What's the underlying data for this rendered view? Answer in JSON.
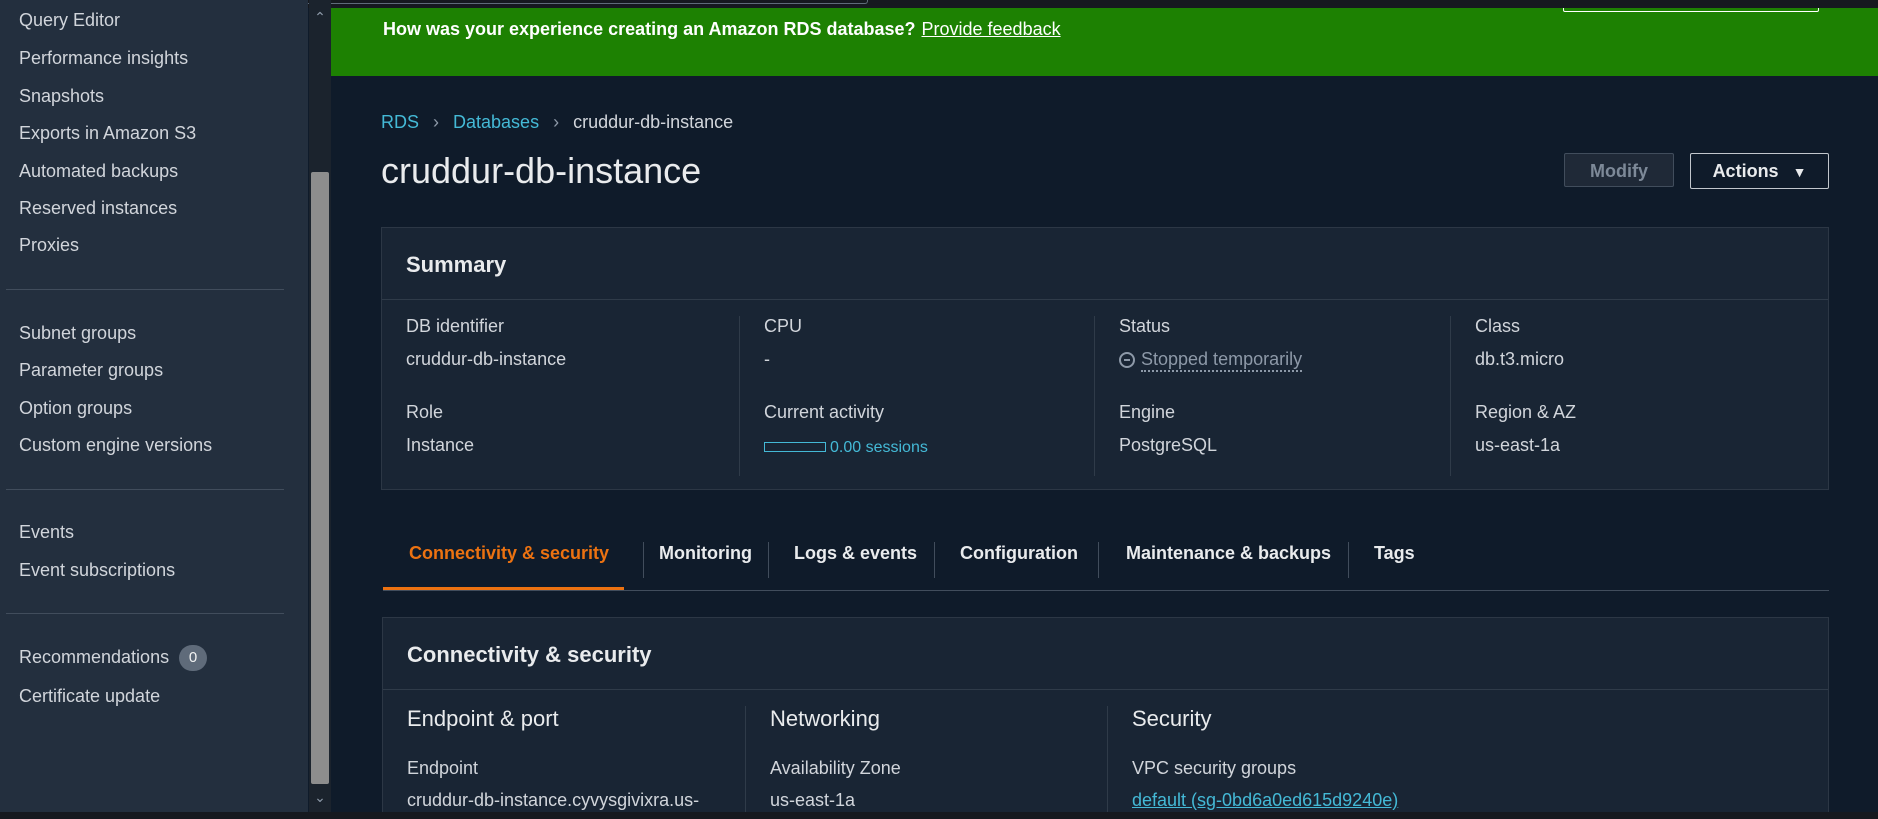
{
  "sidebar": {
    "items": [
      {
        "label": "Query Editor"
      },
      {
        "label": "Performance insights"
      },
      {
        "label": "Snapshots"
      },
      {
        "label": "Exports in Amazon S3"
      },
      {
        "label": "Automated backups"
      },
      {
        "label": "Reserved instances"
      },
      {
        "label": "Proxies"
      },
      {
        "label": "Subnet groups"
      },
      {
        "label": "Parameter groups"
      },
      {
        "label": "Option groups"
      },
      {
        "label": "Custom engine versions"
      },
      {
        "label": "Events"
      },
      {
        "label": "Event subscriptions"
      },
      {
        "label": "Recommendations",
        "badge": "0"
      },
      {
        "label": "Certificate update"
      }
    ]
  },
  "banner": {
    "text": "How was your experience creating an Amazon RDS database?",
    "link": "Provide feedback",
    "color": "#1d8102"
  },
  "breadcrumb": {
    "items": [
      "RDS",
      "Databases"
    ],
    "current": "cruddur-db-instance"
  },
  "page": {
    "title": "cruddur-db-instance",
    "modify_label": "Modify",
    "actions_label": "Actions"
  },
  "summary": {
    "title": "Summary",
    "fields": {
      "db_identifier": {
        "label": "DB identifier",
        "value": "cruddur-db-instance"
      },
      "cpu": {
        "label": "CPU",
        "value": "-"
      },
      "status": {
        "label": "Status",
        "value": "Stopped temporarily"
      },
      "class": {
        "label": "Class",
        "value": "db.t3.micro"
      },
      "role": {
        "label": "Role",
        "value": "Instance"
      },
      "current_activity": {
        "label": "Current activity",
        "value": "0.00 sessions"
      },
      "engine": {
        "label": "Engine",
        "value": "PostgreSQL"
      },
      "region_az": {
        "label": "Region & AZ",
        "value": "us-east-1a"
      }
    }
  },
  "tabs": [
    {
      "label": "Connectivity & security",
      "active": true
    },
    {
      "label": "Monitoring"
    },
    {
      "label": "Logs & events"
    },
    {
      "label": "Configuration"
    },
    {
      "label": "Maintenance & backups"
    },
    {
      "label": "Tags"
    }
  ],
  "connectivity": {
    "title": "Connectivity & security",
    "endpoint_port": {
      "heading": "Endpoint & port",
      "label": "Endpoint",
      "value": "cruddur-db-instance.cyvysgivixra.us-"
    },
    "networking": {
      "heading": "Networking",
      "label": "Availability Zone",
      "value": "us-east-1a"
    },
    "security": {
      "heading": "Security",
      "label": "VPC security groups",
      "value": "default (sg-0bd6a0ed615d9240e)"
    }
  },
  "colors": {
    "accent_orange": "#ec7211",
    "link_blue": "#44b9d6",
    "background": "#0f1b2a",
    "panel": "#192534",
    "sidebar": "#232f3e"
  }
}
